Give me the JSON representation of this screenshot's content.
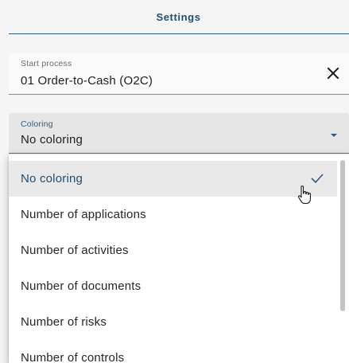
{
  "settings": {
    "title": "Settings"
  },
  "start_process": {
    "label": "Start process",
    "value": "01 Order-to-Cash (O2C)",
    "clear_icon": "close-icon"
  },
  "coloring": {
    "label": "Coloring",
    "value": "No coloring",
    "arrow_icon": "caret-down-icon",
    "options": [
      {
        "label": "No coloring",
        "selected": true
      },
      {
        "label": "Number of applications",
        "selected": false
      },
      {
        "label": "Number of activities",
        "selected": false
      },
      {
        "label": "Number of documents",
        "selected": false
      },
      {
        "label": "Number of risks",
        "selected": false
      },
      {
        "label": "Number of controls",
        "selected": false
      }
    ],
    "selected_icon": "check-icon"
  },
  "colors": {
    "accent": "#1f4e74",
    "selected_option_bg": "#e9e9e9",
    "field_bg": "#e6e6e6",
    "page_bg": "#f5f5f5"
  }
}
